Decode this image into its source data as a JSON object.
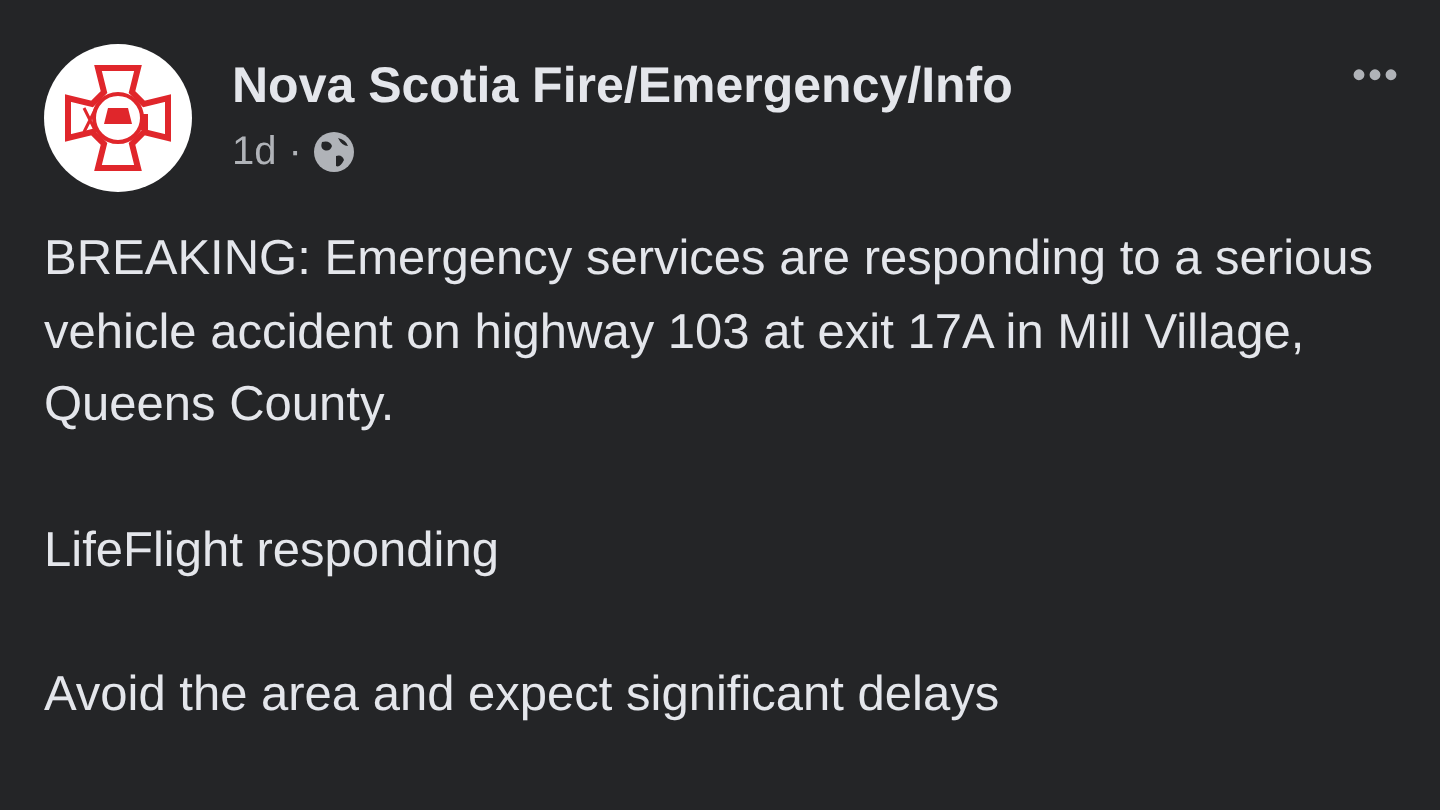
{
  "post": {
    "author": "Nova Scotia Fire/Emergency/Info",
    "time": "1d",
    "separator": "·",
    "menu": "•••",
    "paragraphs": [
      "BREAKING: Emergency services are responding to a serious vehicle accident on highway 103 at exit 17A in Mill Village, Queens County.",
      "LifeFlight responding",
      "Avoid the area and expect significant delays"
    ]
  }
}
